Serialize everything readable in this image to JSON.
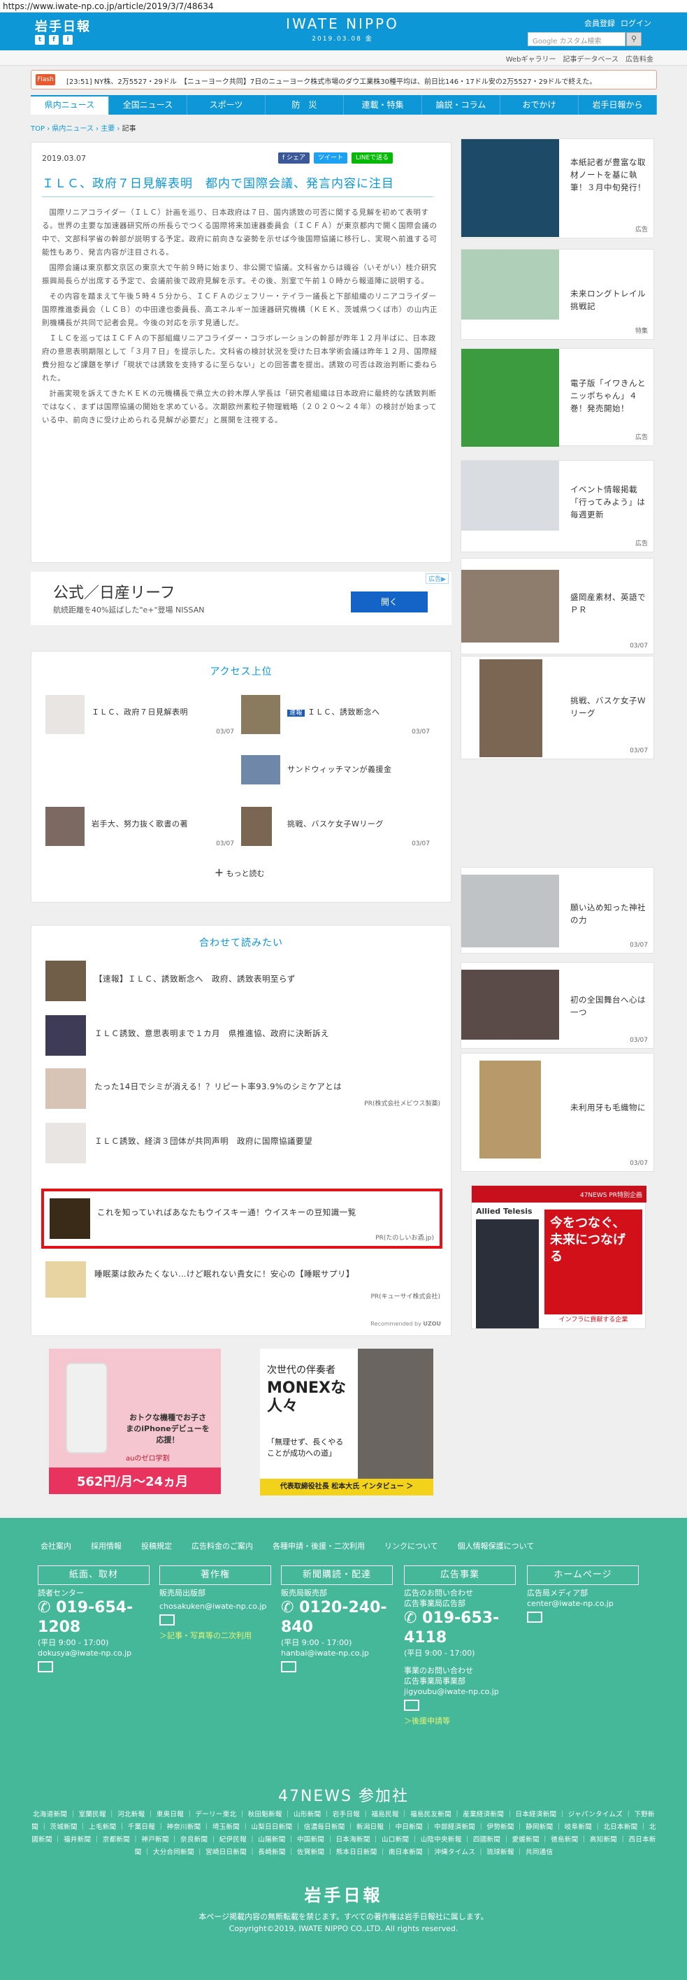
{
  "url": "https://www.iwate-np.co.jp/article/2019/3/7/48634",
  "header": {
    "logo": "岩手日報",
    "site_title": "IWATE NIPPO",
    "date": "2019.03.08 金",
    "member": "会員登録",
    "login": "ログイン",
    "search_placeholder": "Google カスタム検索",
    "sub_links": [
      "Webギャラリー",
      "記事データベース",
      "広告料金"
    ]
  },
  "sns": [
    "t",
    "f",
    "i"
  ],
  "flash": {
    "label": "Flash",
    "text": "[23:51] NY株、2万5527・29ドル　【ニューヨーク共同】7日のニューヨーク株式市場のダウ工業株30種平均は、前日比146・17ドル安の2万5527・29ドルで終えた。"
  },
  "nav": [
    "県内ニュース",
    "全国ニュース",
    "スポーツ",
    "防　災",
    "連載・特集",
    "論説・コラム",
    "おでかけ",
    "岩手日報から"
  ],
  "breadcrumb": {
    "top": "TOP",
    "cat": "県内ニュース",
    "sub": "主要",
    "current": "記事"
  },
  "article": {
    "date": "2019.03.07",
    "share": [
      "f シェア",
      "ツイート",
      "LINEで送る"
    ],
    "title": "ＩＬＣ、政府７日見解表明　都内で国際会議、発言内容に注目",
    "paragraphs": [
      "国際リニアコライダー（ＩＬＣ）計画を巡り、日本政府は７日、国内誘致の可否に関する見解を初めて表明する。世界の主要な加速器研究所の所長らでつくる国際将来加速器委員会（ＩＣＦＡ）が東京都内で開く国際会議の中で、文部科学省の幹部が説明する予定。政府に前向きな姿勢を示せば今後国際協議に移行し、実現へ前進する可能性もあり、発言内容が注目される。",
      "国際会議は東京都文京区の東京大で午前９時に始まり、非公開で協議。文科省からは磯谷（いそがい）桂介研究振興局長らが出席する予定で、会議前後で政府見解を示す。その後、別室で午前１０時から報道陣に説明する。",
      "その内容を踏まえて午後５時４５分から、ＩＣＦＡのジェフリー・テイラー議長と下部組織のリニアコライダー国際推進委員会（ＬＣＢ）の中田達也委員長、高エネルギー加速器研究機構（ＫＥＫ、茨城県つくば市）の山内正則機構長が共同で記者会見。今後の対応を示す見通しだ。",
      "ＩＬＣを巡ってはＩＣＦＡの下部組織リニアコライダー・コラボレーションの幹部が昨年１２月半ばに、日本政府の意思表明期限として「３月７日」を提示した。文科省の検討状況を受けた日本学術会議は昨年１２月、国際経費分担など課題を挙げ「現状では誘致を支持するに至らない」との回答書を提出。誘致の可否は政治判断に委ねられた。",
      "計画実現を訴えてきたＫＥＫの元機構長で県立大の鈴木厚人学長は「研究者組織は日本政府に最終的な誘致判断ではなく、まずは国際協議の開始を求めている。次期欧州素粒子物理戦略（２０２０～２４年）の検討が始まっている中、前向きに受け止められる見解が必要だ」と展開を注視する。"
    ]
  },
  "ad_bar": {
    "title": "公式／日産リーフ",
    "sub": "航続距離を40%延ばした\"e+\"登場 NISSAN",
    "button": "開く",
    "tag": "広告▶"
  },
  "ranking": {
    "title": "アクセス上位",
    "items": [
      {
        "text": "ＩＬＣ、政府７日見解表明",
        "date": "03/07"
      },
      {
        "badge": "速報",
        "text": "ＩＬＣ、誘致断念へ",
        "date": "03/07"
      },
      {
        "text": "サンドウィッチマンが義援金",
        "date": ""
      },
      {
        "text": "岩手大、努力抜く歌書の著",
        "date": "03/07"
      },
      {
        "text": "挑戦、バスケ女子Wリーグ",
        "date": "03/07"
      }
    ],
    "more": "もっと読む"
  },
  "related": {
    "title": "合わせて読みたい",
    "items": [
      {
        "text": "【速報】ＩＬＣ、誘致断念へ　政府、誘致表明至らず",
        "pr": ""
      },
      {
        "text": "ＩＬＣ誘致、意思表明まで１カ月　県推進協、政府に決断訴え",
        "pr": ""
      },
      {
        "text": "たった14日でシミが消える！？リピート率93.9%のシミケアとは",
        "pr": "PR(株式会社メビウス製薬)"
      },
      {
        "text": "ＩＬＣ誘致、経済３団体が共同声明　政府に国際協議要望",
        "pr": ""
      },
      {
        "text": "これを知っていればあなたもウイスキー通！ウイスキーの豆知識一覧",
        "pr": "PR(たのしいお酒.jp)"
      },
      {
        "text": "睡眠薬は飲みたくない…けど眠れない貴女に！安心の【睡眠サプリ】",
        "pr": "PR(キューサイ株式会社)"
      }
    ],
    "recommended": "Recommended by",
    "uzou": "UZOU"
  },
  "side": [
    {
      "text": "本紙記者が豊富な取材ノートを基に執筆！３月中旬発行！",
      "date": "広告"
    },
    {
      "text": "未来ロングトレイル挑戦記",
      "date": "特集"
    },
    {
      "text": "電子版「イワきんとニッポちゃん」４巻！発売開始！",
      "date": "広告"
    },
    {
      "text": "イベント情報掲載「行ってみよう」は毎週更新",
      "date": "広告"
    },
    {
      "text": "盛岡産素材、英語でＰＲ",
      "date": "03/07"
    },
    {
      "text": "挑戦、バスケ女子Ｗリーグ",
      "date": "03/07"
    },
    {
      "text": "願い込め知った神社の力",
      "date": "03/07"
    },
    {
      "text": "初の全国舞台へ心は一つ",
      "date": "03/07"
    },
    {
      "text": "未利用牙も毛織物に",
      "date": "03/07"
    }
  ],
  "side_ads": {
    "monex_title": "次世代の伴奏者",
    "monex_big": "MONEXな人々",
    "monex_sub": "「無理せず、長くやることが成功への道」",
    "monex_foot": "代表取締役社長 松本大氏 インタビュー ＞",
    "at_title": "今をつなぐ、未来につなげる",
    "at_sub": "インフラに貢献する企業",
    "at_brand": "Allied Telesis",
    "at_tag": "47NEWS PR特別企画",
    "iphone_text": "おトクな機種でお子さまのiPhoneデビューを応援！",
    "iphone_price": "562円/月〜24ヵ月",
    "iphone_brand": "auのゼロ学割"
  },
  "footer": {
    "links": [
      "会社案内",
      "採用情報",
      "投稿規定",
      "広告料金のご案内",
      "各種申請・後援・二次利用",
      "リンクについて",
      "個人情報保護について"
    ],
    "cols": [
      {
        "head": "紙面、取材",
        "lines": [
          "読者センター"
        ],
        "tel": "019-654-1208",
        "hours": "(平日 9:00 - 17:00)",
        "mail": "dokusya@iwate-np.co.jp"
      },
      {
        "head": "著作権",
        "lines": [
          "販売局出版部"
        ],
        "mail": "chosakuken@iwate-np.co.jp",
        "link": "＞記事・写真等の二次利用"
      },
      {
        "head": "新聞購読・配達",
        "lines": [
          "販売局販売部"
        ],
        "tel": "0120-240-840",
        "hours": "(平日 9:00 - 17:00)",
        "mail": "hanbai@iwate-np.co.jp"
      },
      {
        "head": "広告事業",
        "lines": [
          "広告のお問い合わせ",
          "広告事業局広告部"
        ],
        "tel": "019-653-4118",
        "hours": "(平日 9:00 - 17:00)",
        "lines2": [
          "事業のお問い合わせ",
          "広告事業局事業部"
        ],
        "mail": "jigyoubu@iwate-np.co.jp",
        "link": "＞後援申請等"
      },
      {
        "head": "ホームページ",
        "lines": [
          "広告局メディア部"
        ],
        "mail": "center@iwate-np.co.jp"
      }
    ],
    "n47": "47NEWS 参加社",
    "papers": "北海道新聞 ｜ 室蘭民報 ｜ 河北新報 ｜ 東奥日報 ｜ デーリー東北 ｜ 秋田魁新報 ｜ 山形新聞 ｜ 岩手日報 ｜ 福島民報 ｜ 福島民友新聞 ｜ 産業経済新聞 ｜ 日本経済新聞 ｜ ジャパンタイムズ ｜ 下野新聞 ｜ 茨城新聞 ｜ 上毛新聞 ｜ 千葉日報 ｜ 神奈川新聞 ｜ 埼玉新聞 ｜ 山梨日日新聞 ｜ 信濃毎日新聞 ｜ 新潟日報 ｜ 中日新聞 ｜ 中部経済新聞 ｜ 伊勢新聞 ｜ 静岡新聞 ｜ 岐阜新聞 ｜ 北日本新聞 ｜ 北國新聞 ｜ 福井新聞 ｜ 京都新聞 ｜ 神戸新聞 ｜ 奈良新聞 ｜ 紀伊民報 ｜ 山陽新聞 ｜ 中国新聞 ｜ 日本海新聞 ｜ 山口新聞 ｜ 山陰中央新報 ｜ 四國新聞 ｜ 愛媛新聞 ｜ 徳島新聞 ｜ 高知新聞 ｜ 西日本新聞 ｜ 大分合同新聞 ｜ 宮崎日日新聞 ｜ 長崎新聞 ｜ 佐賀新聞 ｜ 熊本日日新聞 ｜ 南日本新聞 ｜ 沖縄タイムス ｜ 琉球新報 ｜ 共同通信",
    "logo": "岩手日報",
    "notice": "本ページ掲載内容の無断転載を禁じます。すべての著作権は岩手日報社に属します。",
    "copyright": "Copyright©2019, IWATE NIPPO CO.,LTD. All rights reserved."
  }
}
